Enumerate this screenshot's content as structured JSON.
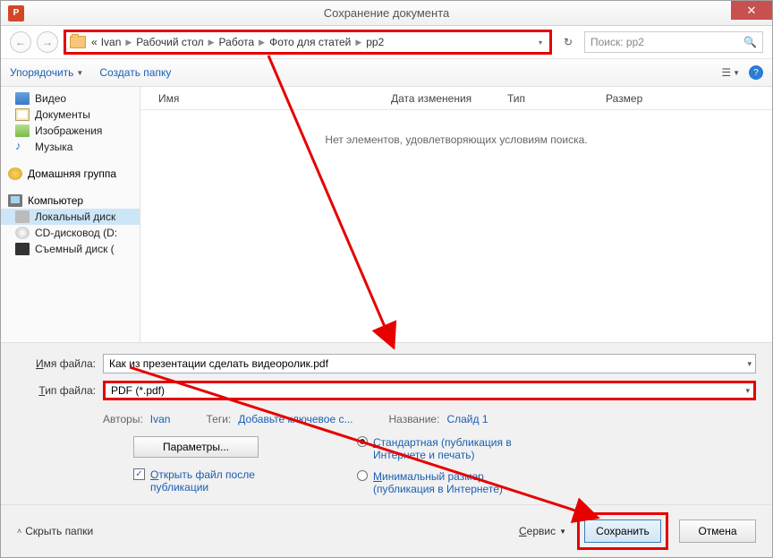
{
  "window": {
    "title": "Сохранение документа"
  },
  "breadcrumb": {
    "prefix": "«",
    "parts": [
      "Ivan",
      "Рабочий стол",
      "Работа",
      "Фото для статей",
      "pp2"
    ]
  },
  "search": {
    "placeholder": "Поиск: pp2"
  },
  "toolbar": {
    "organize": "Упорядочить",
    "new_folder": "Создать папку"
  },
  "sidebar": {
    "items": [
      {
        "label": "Видео"
      },
      {
        "label": "Документы"
      },
      {
        "label": "Изображения"
      },
      {
        "label": "Музыка"
      }
    ],
    "homegroup": "Домашняя группа",
    "computer": "Компьютер",
    "drives": [
      {
        "label": "Локальный диск"
      },
      {
        "label": "CD-дисковод (D:"
      },
      {
        "label": "Съемный диск ("
      }
    ]
  },
  "columns": {
    "name": "Имя",
    "date": "Дата изменения",
    "type": "Тип",
    "size": "Размер"
  },
  "empty_msg": "Нет элементов, удовлетворяющих условиям поиска.",
  "fields": {
    "filename_label": "Имя файла:",
    "filename_value": "Как из презентации сделать видеоролик.pdf",
    "filetype_label": "Тип файла:",
    "filetype_value": "PDF (*.pdf)"
  },
  "meta": {
    "authors_label": "Авторы:",
    "authors_value": "Ivan",
    "tags_label": "Теги:",
    "tags_value": "Добавьте ключевое с...",
    "title_label": "Название:",
    "title_value": "Слайд 1"
  },
  "options": {
    "params_btn": "Параметры...",
    "open_after": "Открыть файл после публикации",
    "radio_standard": "Стандартная (публикация в Интернете и печать)",
    "radio_minimal": "Минимальный размер (публикация в Интернете)"
  },
  "footer": {
    "hide_folders": "Скрыть папки",
    "service": "Сервис",
    "save": "Сохранить",
    "cancel": "Отмена"
  }
}
